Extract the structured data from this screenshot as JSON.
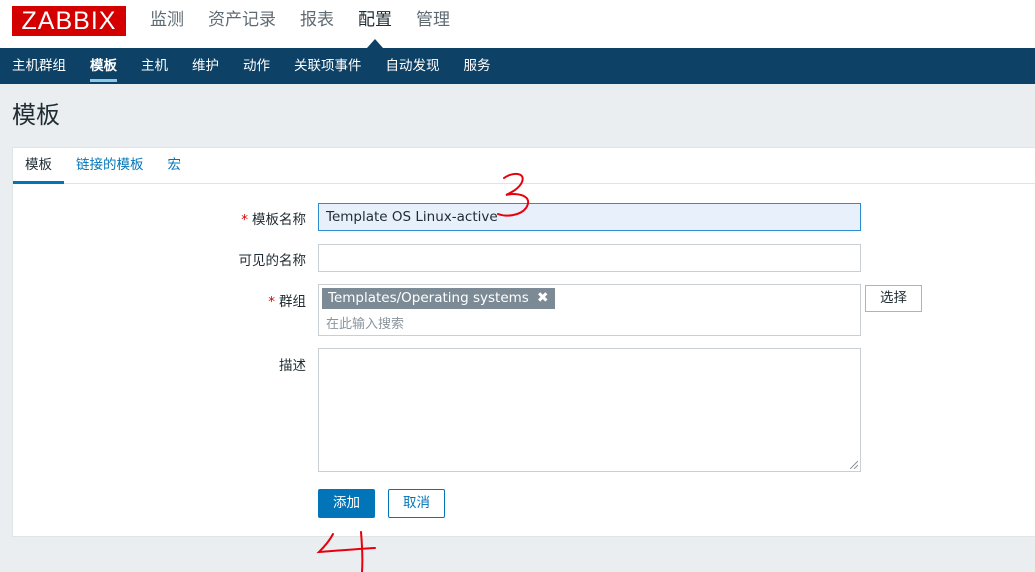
{
  "brand": {
    "logo_text": "ZABBIX",
    "logo_color": "#d40000"
  },
  "top_nav": {
    "items": [
      {
        "label": "监测"
      },
      {
        "label": "资产记录"
      },
      {
        "label": "报表"
      },
      {
        "label": "配置",
        "active": true
      },
      {
        "label": "管理"
      }
    ]
  },
  "sub_nav": {
    "items": [
      {
        "label": "主机群组"
      },
      {
        "label": "模板",
        "active": true
      },
      {
        "label": "主机"
      },
      {
        "label": "维护"
      },
      {
        "label": "动作"
      },
      {
        "label": "关联项事件"
      },
      {
        "label": "自动发现"
      },
      {
        "label": "服务"
      }
    ]
  },
  "page": {
    "title": "模板"
  },
  "tabs": [
    {
      "label": "模板",
      "active": true
    },
    {
      "label": "链接的模板"
    },
    {
      "label": "宏"
    }
  ],
  "form": {
    "required_mark": "*",
    "template_name": {
      "label": "模板名称",
      "value": "Template OS Linux-active",
      "required": true
    },
    "visible_name": {
      "label": "可见的名称",
      "value": ""
    },
    "groups": {
      "label": "群组",
      "required": true,
      "selected": [
        "Templates/Operating systems"
      ],
      "search_placeholder": "在此输入搜索",
      "select_button": "选择"
    },
    "description": {
      "label": "描述",
      "value": ""
    },
    "add_button": "添加",
    "cancel_button": "取消"
  },
  "annotations": {
    "mark_3": "3",
    "mark_4": "4",
    "color": "#e8000b"
  },
  "colors": {
    "header_bg": "#0e4166",
    "accent": "#0275b8",
    "focus_bg": "#e8f0fc"
  }
}
